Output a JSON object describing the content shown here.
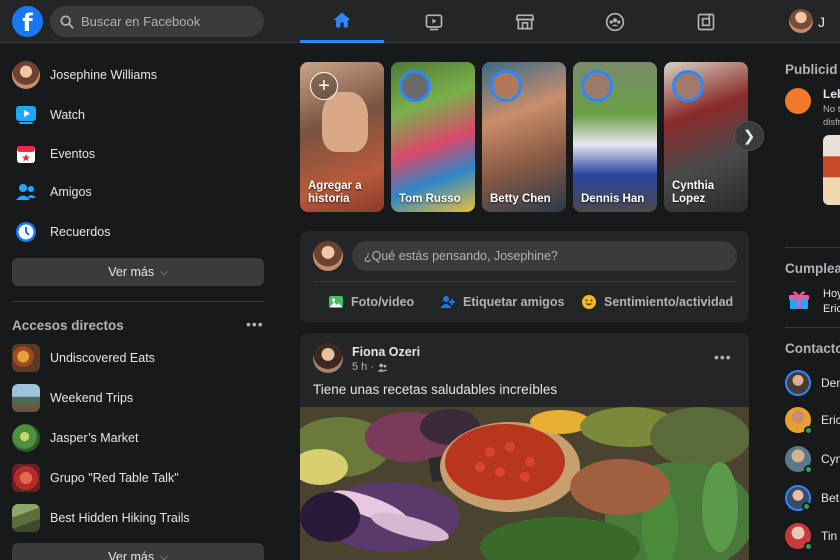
{
  "topbar": {
    "logo": "f",
    "search_placeholder": "Buscar en Facebook",
    "nav_tabs": [
      "home-icon",
      "watch-icon",
      "marketplace-icon",
      "groups-icon",
      "gaming-icon"
    ],
    "active_tab": "home-icon",
    "user_short": "J",
    "accent": "#2d88ff"
  },
  "left": {
    "profile_name": "Josephine Williams",
    "items": [
      {
        "label": "Watch",
        "icon": "watch-icon"
      },
      {
        "label": "Eventos",
        "icon": "calendar-icon"
      },
      {
        "label": "Amigos",
        "icon": "friends-icon"
      },
      {
        "label": "Recuerdos",
        "icon": "clock-icon"
      }
    ],
    "see_more": "Ver más",
    "shortcuts_title": "Accesos directos",
    "shortcuts": [
      {
        "label": "Undiscovered Eats"
      },
      {
        "label": "Weekend Trips"
      },
      {
        "label": "Jasper’s Market"
      },
      {
        "label": "Grupo \"Red Table Talk\""
      },
      {
        "label": "Best Hidden Hiking Trails"
      }
    ],
    "see_more_2": "Ver más"
  },
  "stories": {
    "create_label": "Agregar a historia",
    "items": [
      {
        "name": "Tom Russo"
      },
      {
        "name": "Betty Chen"
      },
      {
        "name": "Dennis Han"
      },
      {
        "name": "Cynthia Lopez"
      }
    ]
  },
  "composer": {
    "placeholder": "¿Qué estás pensando, Josephine?",
    "actions": [
      {
        "label": "Foto/video",
        "icon": "photo-icon",
        "color": "#45bd62"
      },
      {
        "label": "Etiquetar amigos",
        "icon": "tag-friends-icon",
        "color": "#1877f2"
      },
      {
        "label": "Sentimiento/actividad",
        "icon": "emoji-icon",
        "color": "#f7b928"
      }
    ]
  },
  "post": {
    "author": "Fiona Ozeri",
    "time": "5 h ·",
    "text": "Tiene unas recetas saludables increíbles"
  },
  "right": {
    "sponsored_title": "Publicid",
    "sponsored_name": "Leb",
    "sponsored_sub1": "No t",
    "sponsored_sub2": "disfr",
    "birthdays_title": "Cumplea",
    "birthday_line1": "Hoy",
    "birthday_line2": "Eric",
    "contacts_title": "Contacto",
    "contacts": [
      {
        "name": "Den",
        "online": false,
        "ring": true
      },
      {
        "name": "Eric",
        "online": true,
        "ring": false
      },
      {
        "name": "Cyn",
        "online": true,
        "ring": false
      },
      {
        "name": "Bet",
        "online": true,
        "ring": true
      },
      {
        "name": "Tin",
        "online": true,
        "ring": false
      }
    ]
  }
}
